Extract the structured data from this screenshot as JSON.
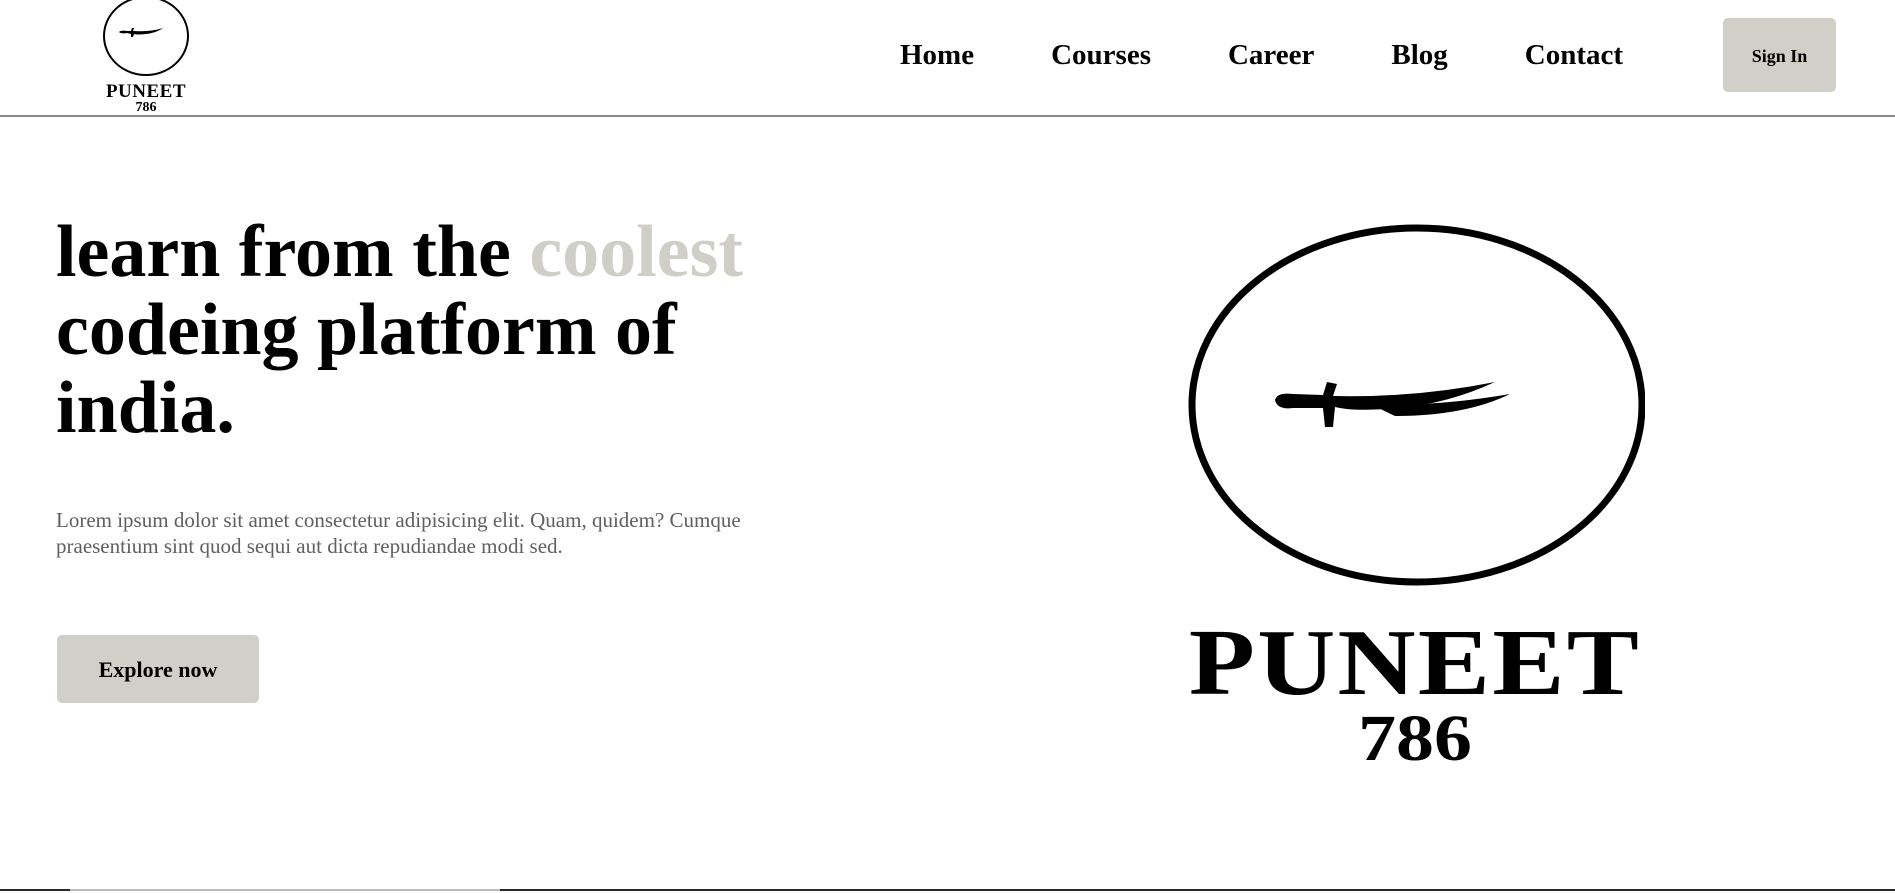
{
  "header": {
    "logo": {
      "brand": "PUNEET",
      "number": "786",
      "icon": "sword-icon"
    },
    "nav": [
      {
        "label": "Home"
      },
      {
        "label": "Courses"
      },
      {
        "label": "Career"
      },
      {
        "label": "Blog"
      },
      {
        "label": "Contact"
      }
    ],
    "signin_label": "Sign In"
  },
  "hero": {
    "title_part1": "learn from the ",
    "title_accent": "coolest",
    "title_part2": " codeing platform of india.",
    "text": "Lorem ipsum dolor sit amet consectetur adipisicing elit. Quam, quidem? Cumque praesentium sint quod sequi aut dicta repudiandae modi sed.",
    "cta_label": "Explore now"
  },
  "hero_logo": {
    "brand": "PUNEET",
    "number": "786",
    "icon": "sword-icon"
  },
  "colors": {
    "accent": "#cfcfc8",
    "button_bg": "#d0d0c9",
    "text_muted": "#5f5f5f"
  }
}
